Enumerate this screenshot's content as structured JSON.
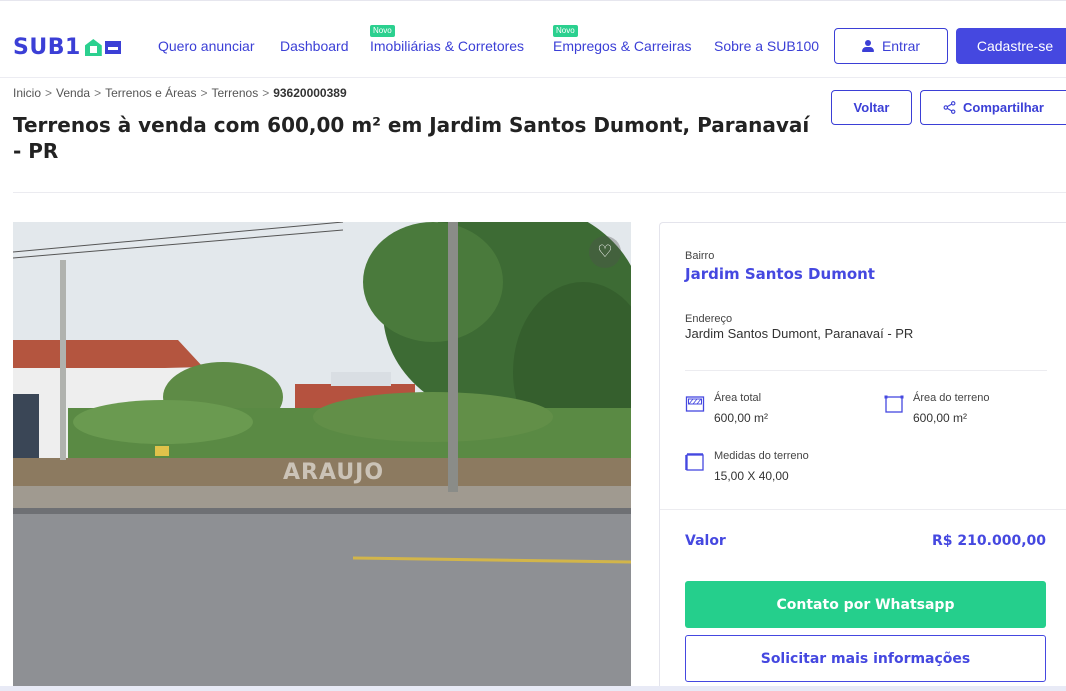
{
  "header": {
    "logo_text": "SUB1",
    "nav": [
      {
        "label": "Quero anunciar",
        "badge": ""
      },
      {
        "label": "Dashboard",
        "badge": ""
      },
      {
        "label": "Imobiliárias & Corretores",
        "badge": "Novo"
      },
      {
        "label": "Empregos & Carreiras",
        "badge": "Novo"
      },
      {
        "label": "Sobre a SUB100",
        "badge": ""
      }
    ],
    "login_label": "Entrar",
    "signup_label": "Cadastre-se"
  },
  "breadcrumb": {
    "items": [
      "Inicio",
      "Venda",
      "Terrenos e Áreas",
      "Terrenos"
    ],
    "separator": ">",
    "code": "93620000389"
  },
  "title": {
    "bold": "Terrenos à venda",
    "rest": " com 600,00 m² em Jardim Santos Dumont, Paranavaí - PR"
  },
  "actions": {
    "back_label": "Voltar",
    "share_label": "Compartilhar"
  },
  "photo": {
    "watermark": "ARAUJO"
  },
  "details": {
    "bairro_label": "Bairro",
    "bairro_value": "Jardim Santos Dumont",
    "endereco_label": "Endereço",
    "endereco_value": "Jardim Santos Dumont, Paranavaí - PR",
    "features": [
      {
        "label": "Área total",
        "value": "600,00 m²",
        "icon": "area-total-icon"
      },
      {
        "label": "Área do terreno",
        "value": "600,00 m²",
        "icon": "area-terreno-icon"
      },
      {
        "label": "Medidas do terreno",
        "value": "15,00 X 40,00",
        "icon": "medidas-icon"
      }
    ],
    "valor_label": "Valor",
    "valor_value": "R$ 210.000,00",
    "whatsapp_label": "Contato por Whatsapp",
    "info_label": "Solicitar mais informações"
  },
  "colors": {
    "brand": "#3b3fd6",
    "accent_green": "#25cf8c"
  }
}
